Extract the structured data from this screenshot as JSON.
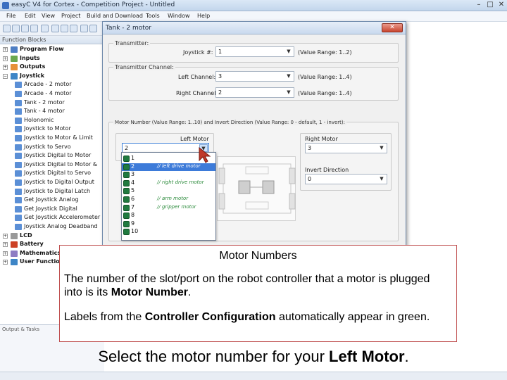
{
  "app": {
    "title": "easyC V4 for Cortex - Competition Project - Untitled",
    "menu": [
      "File",
      "Edit",
      "View",
      "Project",
      "Build and Download",
      "Tools",
      "Window",
      "Help"
    ]
  },
  "function_panel": {
    "title": "Function Blocks",
    "tree": [
      {
        "label": "Program Flow",
        "kind": "category",
        "expander": "+"
      },
      {
        "label": "Inputs",
        "kind": "category",
        "expander": "+"
      },
      {
        "label": "Outputs",
        "kind": "category",
        "expander": "+"
      },
      {
        "label": "Joystick",
        "kind": "category",
        "expander": "−"
      },
      {
        "label": "Arcade - 2 motor",
        "kind": "item"
      },
      {
        "label": "Arcade - 4 motor",
        "kind": "item"
      },
      {
        "label": "Tank - 2 motor",
        "kind": "item"
      },
      {
        "label": "Tank - 4 motor",
        "kind": "item"
      },
      {
        "label": "Holonomic",
        "kind": "item"
      },
      {
        "label": "Joystick to Motor",
        "kind": "item"
      },
      {
        "label": "Joystick to Motor & Limit",
        "kind": "item"
      },
      {
        "label": "Joystick to Servo",
        "kind": "item"
      },
      {
        "label": "Joystick Digital to Motor",
        "kind": "item"
      },
      {
        "label": "Joystick Digital to Motor &",
        "kind": "item"
      },
      {
        "label": "Joystick Digital to Servo",
        "kind": "item"
      },
      {
        "label": "Joystick to Digital Output",
        "kind": "item"
      },
      {
        "label": "Joystick to Digital Latch",
        "kind": "item"
      },
      {
        "label": "Get Joystick Analog",
        "kind": "item"
      },
      {
        "label": "Get Joystick Digital",
        "kind": "item"
      },
      {
        "label": "Get Joystick Accelerometer",
        "kind": "item"
      },
      {
        "label": "Joystick Analog Deadband",
        "kind": "item"
      },
      {
        "label": "LCD",
        "kind": "category",
        "expander": "+"
      },
      {
        "label": "Battery",
        "kind": "category",
        "expander": "+"
      },
      {
        "label": "Mathematics",
        "kind": "category",
        "expander": "+"
      },
      {
        "label": "User Functions",
        "kind": "category",
        "expander": "+"
      }
    ]
  },
  "bottom_panel": {
    "title": "Output & Tasks"
  },
  "dialog": {
    "title": "Tank - 2 motor",
    "close_label": "✕",
    "transmitter": {
      "group_title": "Transmitter:",
      "joystick_label": "Joystick #:",
      "joystick_value": "1",
      "joystick_range": "(Value Range: 1..2)"
    },
    "channel": {
      "group_title": "Transmitter Channel:",
      "left_label": "Left Channel:",
      "left_value": "3",
      "left_range": "(Value Range: 1..4)",
      "right_label": "Right Channel:",
      "right_value": "2",
      "right_range": "(Value Range: 1..4)"
    },
    "motor": {
      "group_title": "Motor Number (Value Range: 1..10) and Invert Direction (Value Range: 0 - default, 1 - invert):",
      "left_motor_label": "Left Motor",
      "left_motor_value": "2",
      "right_motor_label": "Right Motor",
      "right_motor_value": "3",
      "invert_label": "Invert Direction",
      "invert_value": "0",
      "options": [
        {
          "n": "1",
          "label": ""
        },
        {
          "n": "2",
          "label": "// left drive motor"
        },
        {
          "n": "3",
          "label": ""
        },
        {
          "n": "4",
          "label": "// right drive motor"
        },
        {
          "n": "5",
          "label": ""
        },
        {
          "n": "6",
          "label": "// arm motor"
        },
        {
          "n": "7",
          "label": "// gripper motor"
        },
        {
          "n": "8",
          "label": ""
        },
        {
          "n": "9",
          "label": ""
        },
        {
          "n": "10",
          "label": ""
        }
      ],
      "selected_option": "2"
    }
  },
  "callout": {
    "title": "Motor Numbers",
    "p1_before": "The number of the slot/port on the robot controller that a motor is plugged into is its ",
    "p1_bold": "Motor Number",
    "p1_after": ".",
    "p2_before": "Labels from the ",
    "p2_bold": "Controller Configuration",
    "p2_after": " automatically appear in green."
  },
  "instruction": {
    "before": "Select the motor number for your ",
    "bold": "Left Motor",
    "after": "."
  },
  "colors": {
    "highlight": "#3d7bd9",
    "config_label_green": "#2a8a3a",
    "callout_border": "#c05050"
  }
}
